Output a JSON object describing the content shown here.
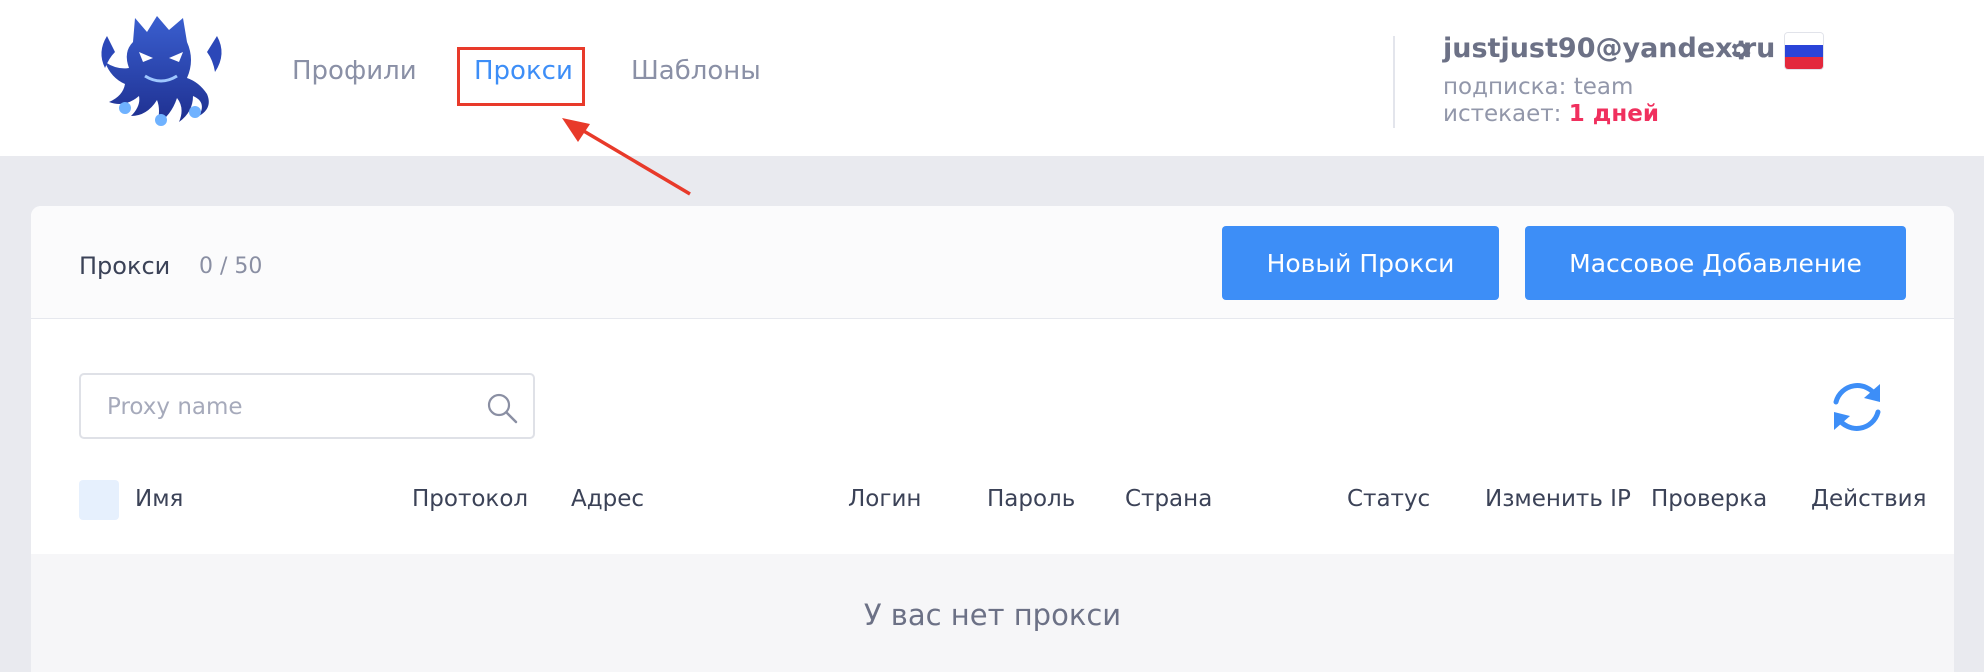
{
  "nav": {
    "items": [
      {
        "label": "Профили",
        "active": false
      },
      {
        "label": "Прокси",
        "active": true
      },
      {
        "label": "Шаблоны",
        "active": false
      }
    ]
  },
  "user": {
    "email": "justjust90@yandex.ru",
    "subscription_label": "подписка:",
    "subscription_value": "team",
    "expires_label": "истекает:",
    "expires_value": "1 дней",
    "language_flag": "russia-flag-icon"
  },
  "panel": {
    "title": "Прокси",
    "count": "0 / 50",
    "new_proxy_label": "Новый Прокси",
    "bulk_add_label": "Массовое Добавление"
  },
  "search": {
    "placeholder": "Proxy name",
    "value": ""
  },
  "table": {
    "columns": [
      "Имя",
      "Протокол",
      "Адрес",
      "Логин",
      "Пароль",
      "Страна",
      "Статус",
      "Изменить IP",
      "Проверка",
      "Действия"
    ],
    "empty_message": "У вас нет прокси"
  },
  "colors": {
    "accent": "#3d8ef7",
    "danger": "#f0305e",
    "annotation": "#e83a2a"
  }
}
